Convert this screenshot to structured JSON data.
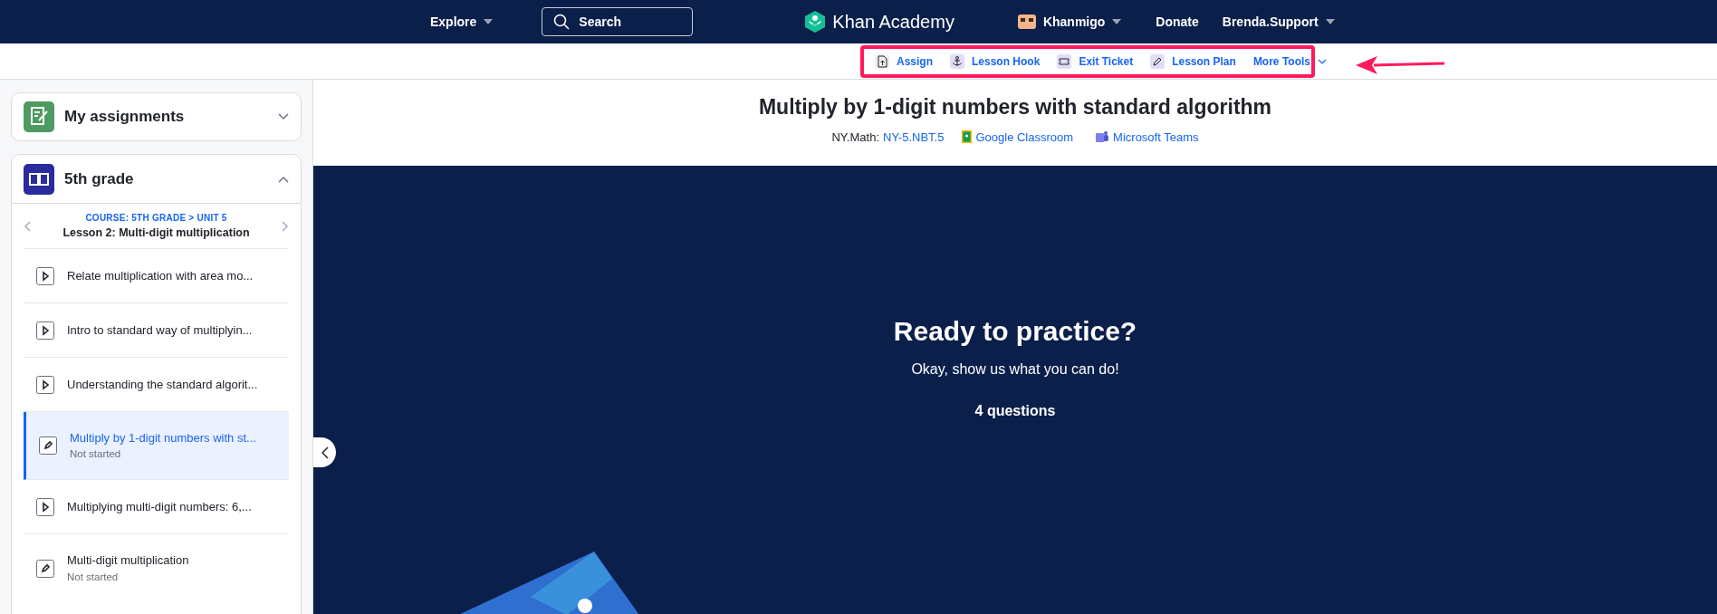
{
  "top_nav": {
    "explore": "Explore",
    "search": {
      "placeholder": "Search"
    },
    "logo": "Khan Academy",
    "khanmigo": "Khanmigo",
    "donate": "Donate",
    "user": "Brenda.Support"
  },
  "toolbar": [
    {
      "kind": "assign",
      "label": "Assign"
    },
    {
      "kind": "hook",
      "label": "Lesson Hook"
    },
    {
      "kind": "ticket",
      "label": "Exit Ticket"
    },
    {
      "kind": "plan",
      "label": "Lesson Plan"
    },
    {
      "kind": "more",
      "label": "More Tools"
    }
  ],
  "sidebar": {
    "assignments": {
      "title": "My assignments",
      "expanded": false
    },
    "course": {
      "title": "5th grade",
      "expanded": true,
      "breadcrumb": "COURSE: 5TH GRADE > UNIT 5",
      "lesson": "Lesson 2: Multi-digit multiplication",
      "items": [
        {
          "kind": "video",
          "title": "Relate multiplication with area mo...",
          "selected": false
        },
        {
          "kind": "video",
          "title": "Intro to standard way of multiplyin...",
          "selected": false
        },
        {
          "kind": "video",
          "title": "Understanding the standard algorit...",
          "selected": false
        },
        {
          "kind": "exercise",
          "title": "Multiply by 1-digit numbers with st...",
          "status": "Not started",
          "selected": true
        },
        {
          "kind": "video",
          "title": "Multiplying multi-digit numbers: 6,...",
          "selected": false
        },
        {
          "kind": "exercise",
          "title": "Multi-digit multiplication",
          "status": "Not started",
          "selected": false
        }
      ]
    }
  },
  "content": {
    "title": "Multiply by 1-digit numbers with standard algorithm",
    "standard_label": "NY.Math:",
    "standard_code": "NY-5.NBT.5",
    "google_classroom": "Google Classroom",
    "microsoft_teams": "Microsoft Teams",
    "practice": {
      "heading": "Ready to practice?",
      "subtitle": "Okay, show us what you can do!",
      "count": "4 questions"
    }
  }
}
